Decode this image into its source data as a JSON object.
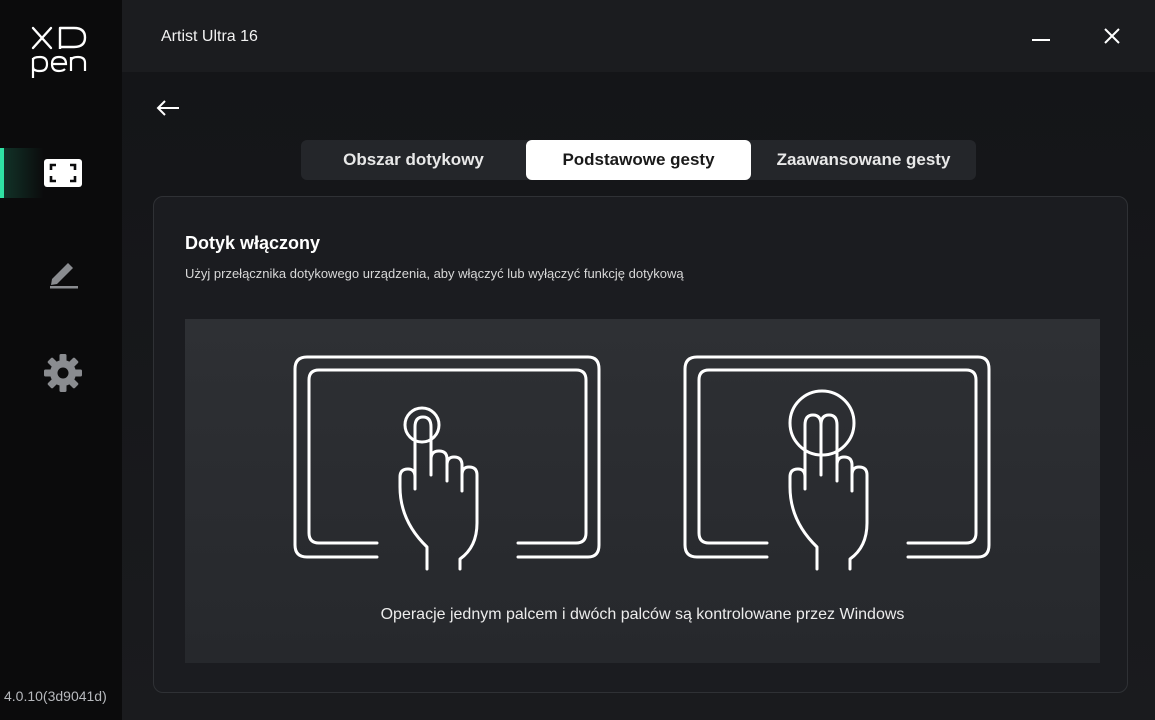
{
  "app": {
    "title": "Artist Ultra 16",
    "version": "4.0.10(3d9041d)",
    "accent_color": "#2fe2a4"
  },
  "sidebar": {
    "items": [
      {
        "name": "touch-area",
        "icon": "screen-frame-icon",
        "active": true
      },
      {
        "name": "pen",
        "icon": "pen-icon",
        "active": false
      },
      {
        "name": "settings",
        "icon": "gear-icon",
        "active": false
      }
    ]
  },
  "window": {
    "minimize_icon": "minimize-icon",
    "close_icon": "close-icon"
  },
  "tabs": [
    {
      "label": "Obszar dotykowy",
      "active": false
    },
    {
      "label": "Podstawowe gesty",
      "active": true
    },
    {
      "label": "Zaawansowane gesty",
      "active": false
    }
  ],
  "panel": {
    "title": "Dotyk włączony",
    "description": "Użyj przełącznika dotykowego urządzenia, aby włączyć lub wyłączyć funkcję dotykową",
    "caption": "Operacje jednym palcem i dwóch palców są kontrolowane przez Windows"
  }
}
